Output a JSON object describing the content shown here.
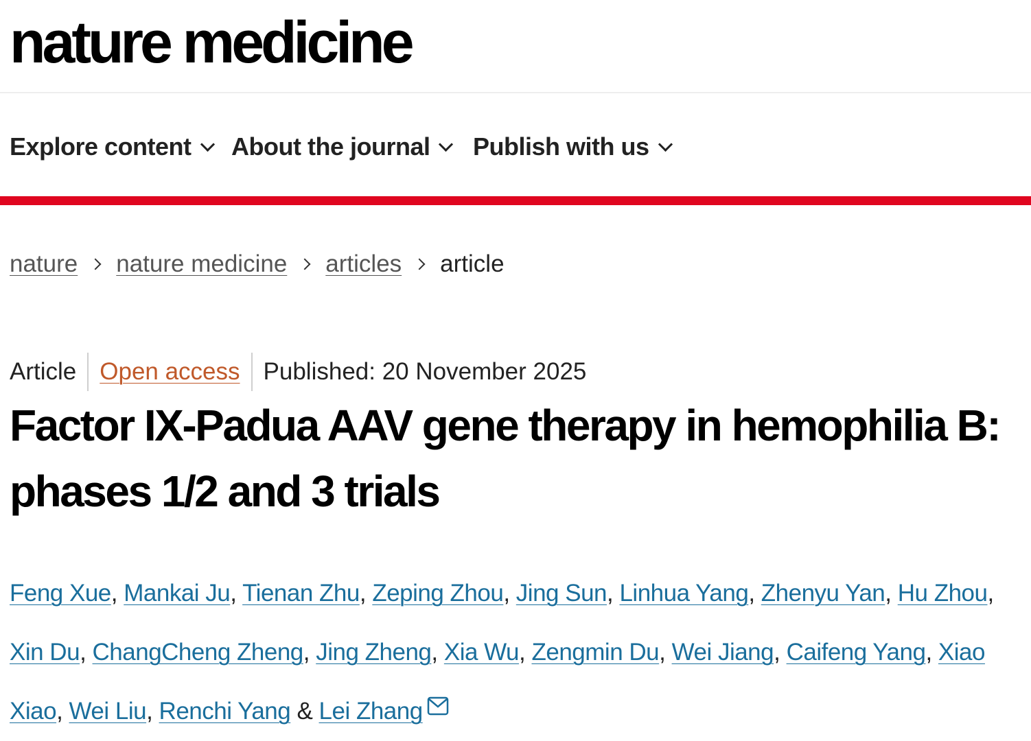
{
  "header": {
    "logo": "nature medicine"
  },
  "nav": {
    "items": [
      {
        "label": "Explore content"
      },
      {
        "label": "About the journal"
      },
      {
        "label": "Publish with us"
      }
    ]
  },
  "colors": {
    "accent_bar": "#e0061f",
    "link": "#1a6e9c",
    "open_access": "#c0592a"
  },
  "breadcrumb": {
    "items": [
      {
        "label": "nature"
      },
      {
        "label": "nature medicine"
      },
      {
        "label": "articles"
      }
    ],
    "current": "article"
  },
  "article": {
    "type": "Article",
    "access": "Open access",
    "published": "Published: 20 November 2025",
    "title": "Factor IX-Padua AAV gene therapy in hemophilia B: phases 1/2 and 3 trials",
    "authors": [
      "Feng Xue",
      "Mankai Ju",
      "Tienan Zhu",
      "Zeping Zhou",
      "Jing Sun",
      "Linhua Yang",
      "Zhenyu Yan",
      "Hu Zhou",
      "Xin Du",
      "ChangCheng Zheng",
      "Jing Zheng",
      "Xia Wu",
      "Zengmin Du",
      "Wei Jiang",
      "Caifeng Yang",
      "Xiao Xiao",
      "Wei Liu",
      "Renchi Yang",
      "Lei Zhang"
    ],
    "author_separator": ", ",
    "author_final_separator": " & ",
    "corresponding_icon": "mail-icon"
  }
}
